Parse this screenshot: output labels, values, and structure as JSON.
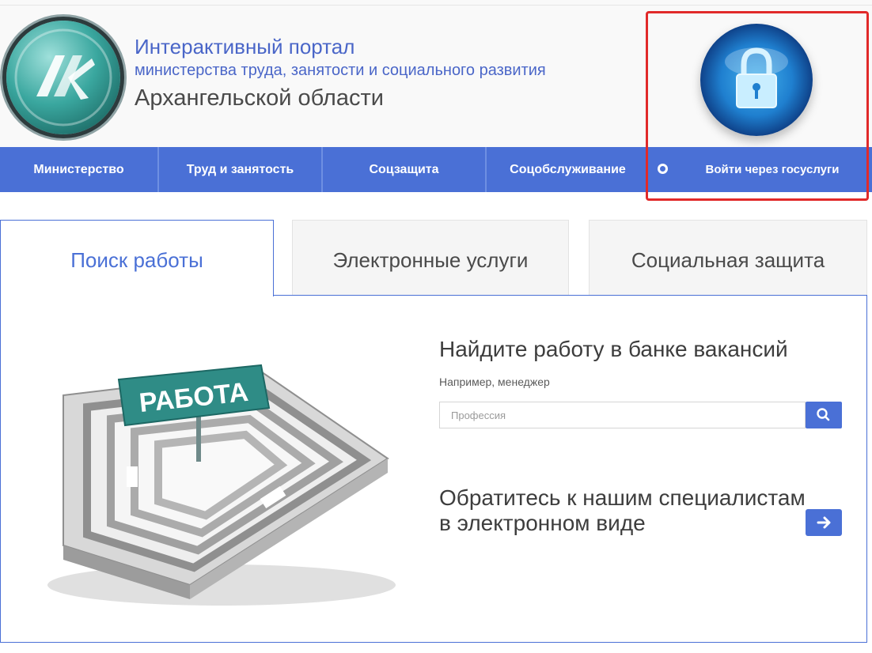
{
  "header": {
    "title": "Интерактивный портал",
    "subtitle": "министерства труда, занятости и социального развития",
    "region": "Архангельской области"
  },
  "nav": {
    "items": [
      {
        "label": "Министерство"
      },
      {
        "label": "Труд и занятость"
      },
      {
        "label": "Соцзащита"
      },
      {
        "label": "Соцобслуживание"
      }
    ],
    "gosuslugi_label": "Войти через госуслуги"
  },
  "tabs": [
    {
      "label": "Поиск работы",
      "active": true
    },
    {
      "label": "Электронные услуги",
      "active": false
    },
    {
      "label": "Социальная защита",
      "active": false
    }
  ],
  "illustration": {
    "sign_text": "РАБОТА"
  },
  "search": {
    "title": "Найдите работу в банке вакансий",
    "hint": "Например, менеджер",
    "placeholder": "Профессия",
    "value": ""
  },
  "contact": {
    "line1": "Обратитесь к нашим специалистам",
    "line2": "в электронном виде"
  },
  "icons": {
    "lock": "lock-icon",
    "search": "search-icon",
    "arrow": "arrow-right-icon",
    "login_circle": "circle-icon"
  },
  "colors": {
    "accent": "#4a70d6",
    "highlight_box": "#e12a2a",
    "title_text": "#4a66c8"
  }
}
